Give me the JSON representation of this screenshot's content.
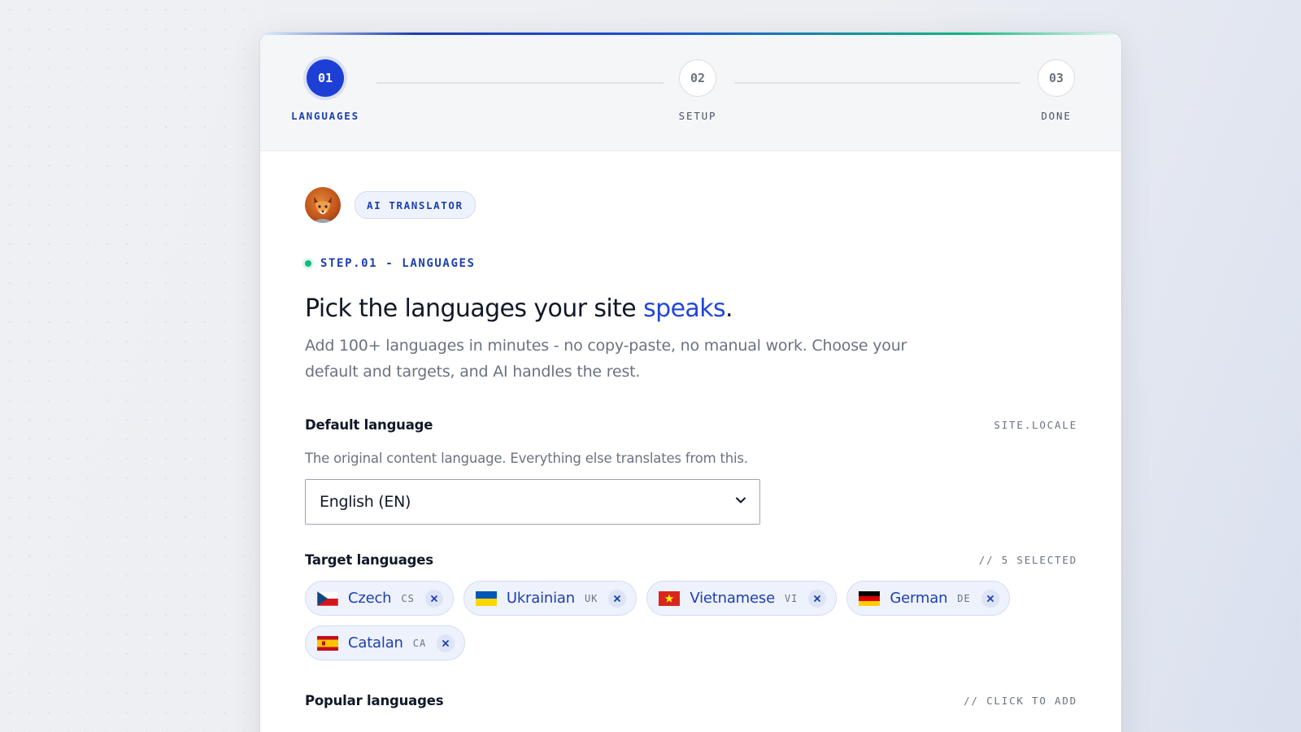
{
  "stepper": {
    "steps": [
      {
        "number": "01",
        "label": "LANGUAGES",
        "state": "active"
      },
      {
        "number": "02",
        "label": "SETUP",
        "state": "idle"
      },
      {
        "number": "03",
        "label": "DONE",
        "state": "idle"
      }
    ]
  },
  "brand": {
    "badge_label": "AI TRANSLATOR",
    "avatar_icon": "fox-avatar-icon"
  },
  "step_tag": "STEP.01 - LANGUAGES",
  "heading": {
    "prefix": "Pick the languages your site ",
    "accent": "speaks",
    "suffix": "."
  },
  "subtitle": "Add 100+ languages in minutes - no copy-paste, no manual work. Choose your default and targets, and AI handles the rest.",
  "default_language": {
    "title": "Default language",
    "meta": "SITE.LOCALE",
    "helper": "The original content language. Everything else translates from this.",
    "selected": "English (EN)"
  },
  "target_languages": {
    "title": "Target languages",
    "meta": "// 5 SELECTED",
    "items": [
      {
        "name": "Czech",
        "code": "CS",
        "flag": "czech-flag-icon"
      },
      {
        "name": "Ukrainian",
        "code": "UK",
        "flag": "ukrainian-flag-icon"
      },
      {
        "name": "Vietnamese",
        "code": "VI",
        "flag": "vietnamese-flag-icon"
      },
      {
        "name": "German",
        "code": "DE",
        "flag": "german-flag-icon"
      },
      {
        "name": "Catalan",
        "code": "CA",
        "flag": "catalan-flag-icon"
      }
    ]
  },
  "popular_languages": {
    "title": "Popular languages",
    "meta": "// CLICK TO ADD"
  },
  "colors": {
    "accent": "#1d3fd6",
    "accent_text": "#1e3fae",
    "status_green": "#10b981",
    "chip_bg": "#eef2fc"
  }
}
